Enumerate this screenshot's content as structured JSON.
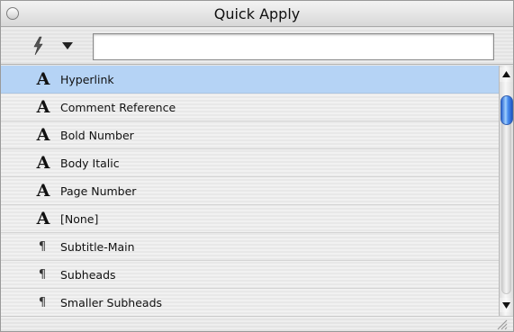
{
  "window": {
    "title": "Quick Apply"
  },
  "toolbar": {
    "search_value": "",
    "search_placeholder": ""
  },
  "list": {
    "selected_index": 0,
    "items": [
      {
        "label": "Hyperlink",
        "icon": "character-style-icon",
        "glyph": "A"
      },
      {
        "label": "Comment Reference",
        "icon": "character-style-icon",
        "glyph": "A"
      },
      {
        "label": "Bold Number",
        "icon": "character-style-icon",
        "glyph": "A"
      },
      {
        "label": "Body Italic",
        "icon": "character-style-icon",
        "glyph": "A"
      },
      {
        "label": "Page Number",
        "icon": "character-style-icon",
        "glyph": "A"
      },
      {
        "label": "[None]",
        "icon": "character-style-icon",
        "glyph": "A"
      },
      {
        "label": "Subtitle-Main",
        "icon": "paragraph-style-icon",
        "glyph": "¶"
      },
      {
        "label": "Subheads",
        "icon": "paragraph-style-icon",
        "glyph": "¶"
      },
      {
        "label": "Smaller Subheads",
        "icon": "paragraph-style-icon",
        "glyph": "¶"
      }
    ]
  },
  "scrollbar": {
    "position_fraction": 0.1
  },
  "colors": {
    "selection": "#b5d3f5",
    "thumb": "#3b7be0"
  }
}
